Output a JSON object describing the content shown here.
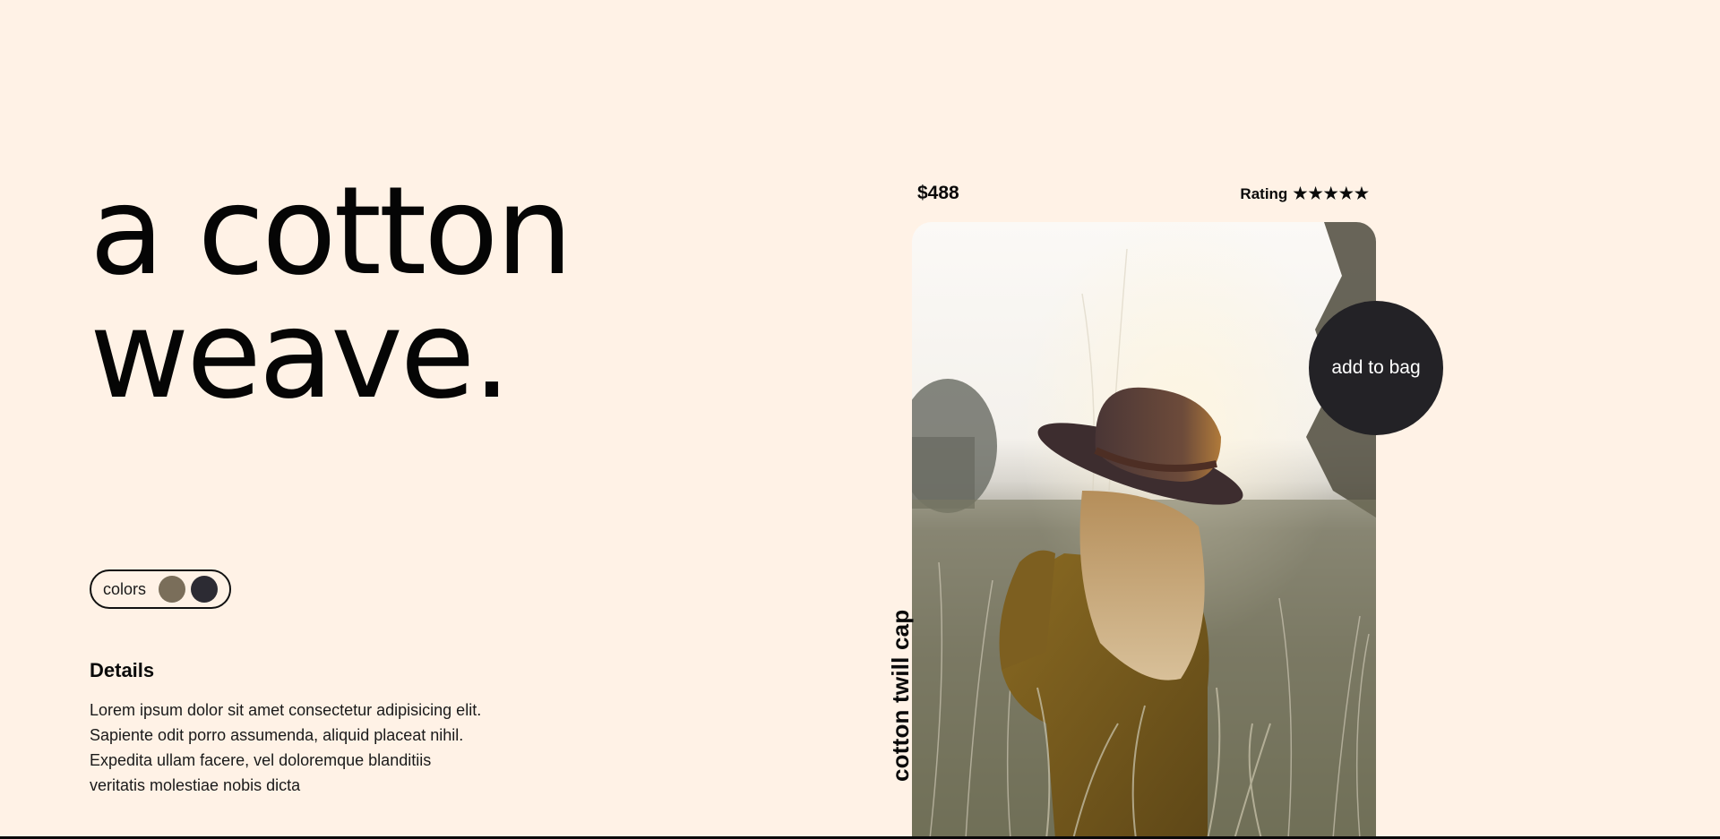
{
  "hero": {
    "line1": "a cotton",
    "line2": "weave."
  },
  "colors": {
    "label": "colors",
    "swatches": [
      {
        "name": "olive-brown",
        "hex": "#7a6e5a"
      },
      {
        "name": "charcoal",
        "hex": "#2c2b33"
      }
    ]
  },
  "details": {
    "heading": "Details",
    "lines": [
      "Lorem ipsum dolor sit amet consectetur adipisicing elit.",
      "Sapiente odit porro assumenda, aliquid placeat nihil.",
      "Expedita ullam facere, vel doloremque blanditiis",
      "veritatis molestiae nobis dicta"
    ]
  },
  "product": {
    "price": "$488",
    "rating_label": "Rating",
    "rating_stars": "★★★★★",
    "name": "cotton twill cap",
    "add_to_bag": "add to bag"
  },
  "theme": {
    "background": "#fff2e6",
    "button": "#232226",
    "text": "#0a0a0a"
  }
}
